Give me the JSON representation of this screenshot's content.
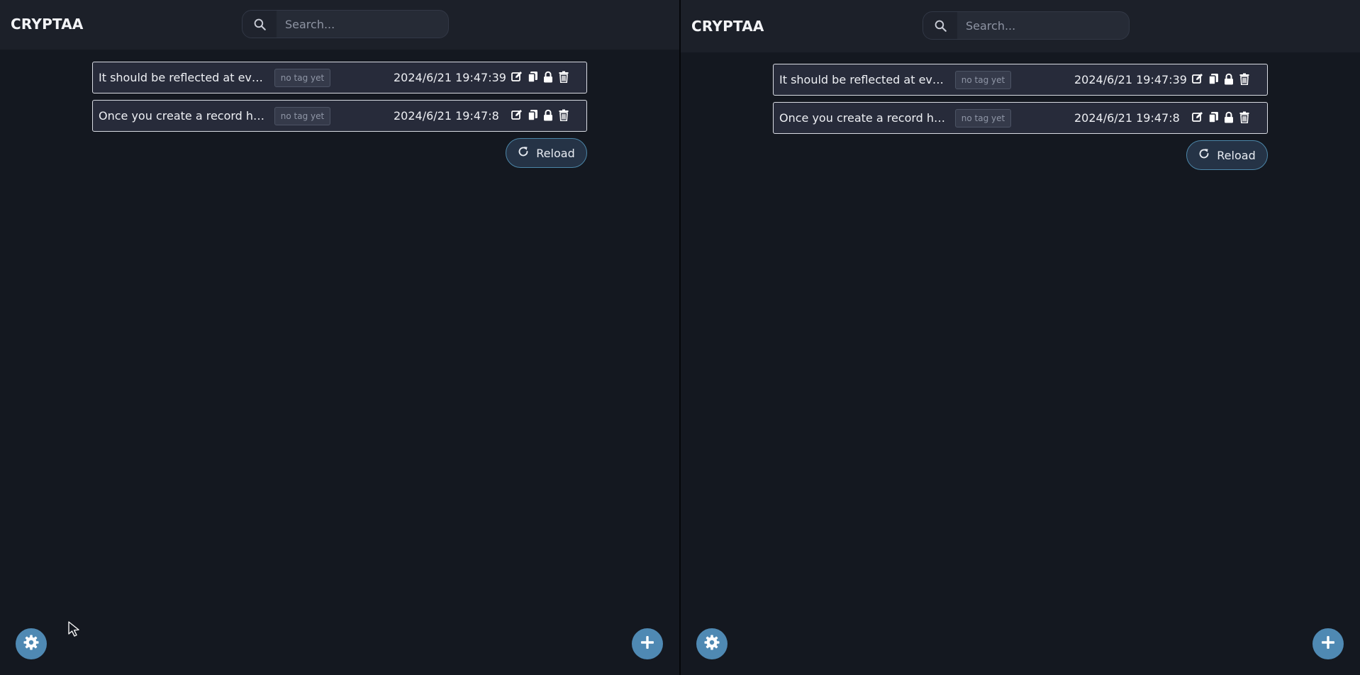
{
  "panes": [
    {
      "brand": "CRYPTAA",
      "search": {
        "placeholder": "Search..."
      },
      "records": [
        {
          "title": "It should be reflected at every device",
          "tag": "no tag yet",
          "timestamp": "2024/6/21 19:47:39"
        },
        {
          "title": "Once you create a record here",
          "tag": "no tag yet",
          "timestamp": "2024/6/21 19:47:8"
        }
      ],
      "reload_label": "Reload"
    },
    {
      "brand": "CRYPTAA",
      "search": {
        "placeholder": "Search..."
      },
      "records": [
        {
          "title": "It should be reflected at every device",
          "tag": "no tag yet",
          "timestamp": "2024/6/21 19:47:39"
        },
        {
          "title": "Once you create a record here",
          "tag": "no tag yet",
          "timestamp": "2024/6/21 19:47:8"
        }
      ],
      "reload_label": "Reload"
    }
  ],
  "icons": {
    "search": "search-icon",
    "edit": "edit-icon",
    "copy": "copy-icon",
    "lock": "lock-icon",
    "delete": "trash-icon",
    "reload": "reload-icon",
    "settings": "gear-icon",
    "add": "plus-icon"
  },
  "colors": {
    "background": "#141820",
    "header": "#1c2029",
    "row": "#272b3a",
    "accent": "#4f89b3",
    "reload_border": "#4c86a8"
  }
}
